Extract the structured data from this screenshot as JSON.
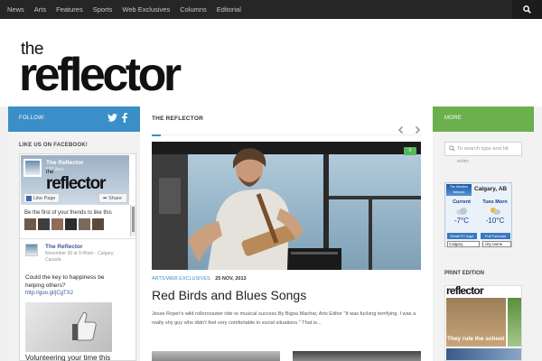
{
  "topnav": {
    "items": [
      "News",
      "Arts",
      "Features",
      "Sports",
      "Web Exclusives",
      "Columns",
      "Editorial"
    ]
  },
  "logo": {
    "small": "the",
    "big": "reflector"
  },
  "left": {
    "follow_label": "FOLLOW:",
    "like_title": "LIKE US ON FACEBOOK!",
    "fb": {
      "page_name": "The Reflector",
      "likes": "592 likes",
      "header_small": "the",
      "header_big": "reflector",
      "like_button": "Like Page",
      "share_button": "Share",
      "friends_text": "Be the first of your friends to like this",
      "post_name": "The Reflector",
      "post_meta": "November 30 at 9:45am · Calgary, Canada",
      "post_text": "Could the key to happiness be helping others?",
      "post_link": "http://goo.gl/jCgTX2",
      "card_title": "Volunteering your time this holiday"
    }
  },
  "center": {
    "section_label": "THE REFLECTOR",
    "comments_count": "0",
    "categories": [
      "ARTS",
      "WEB EXCLUSIVES"
    ],
    "separator": "/",
    "date": "25 NOV, 2013",
    "title": "Red Birds and Blues Songs",
    "excerpt": "Jesse Roper's wild rollercoaster ride to musical success  By Bigoa Machar, Arts Editor   \"It was fucking terrifying. I was a really shy guy who didn't feel very comfortable in social situations.\" That is..."
  },
  "right": {
    "more_label": "MORE",
    "search_placeholder": "To search type and hit enter",
    "weather": {
      "logo": "The Weather Network",
      "city": "Calgary, AB",
      "col1_label": "Current",
      "col2_label": "Tues Morn",
      "temp1": "-7°C",
      "temp2": "-10°C",
      "link1": "Detail FC Appr",
      "link2": "Full Forecast",
      "select_value": "Calgary",
      "city_input": "city name"
    },
    "print_label": "PRINT EDITION",
    "print_cover_word": "reflector",
    "print_cover_headline": "They rule the school"
  },
  "colors": {
    "topnav_bg": "#262626",
    "follow_blue": "#3a8fc8",
    "more_green": "#6ab04c",
    "badge_green": "#57b65a",
    "link_blue": "#3a8fc8"
  }
}
